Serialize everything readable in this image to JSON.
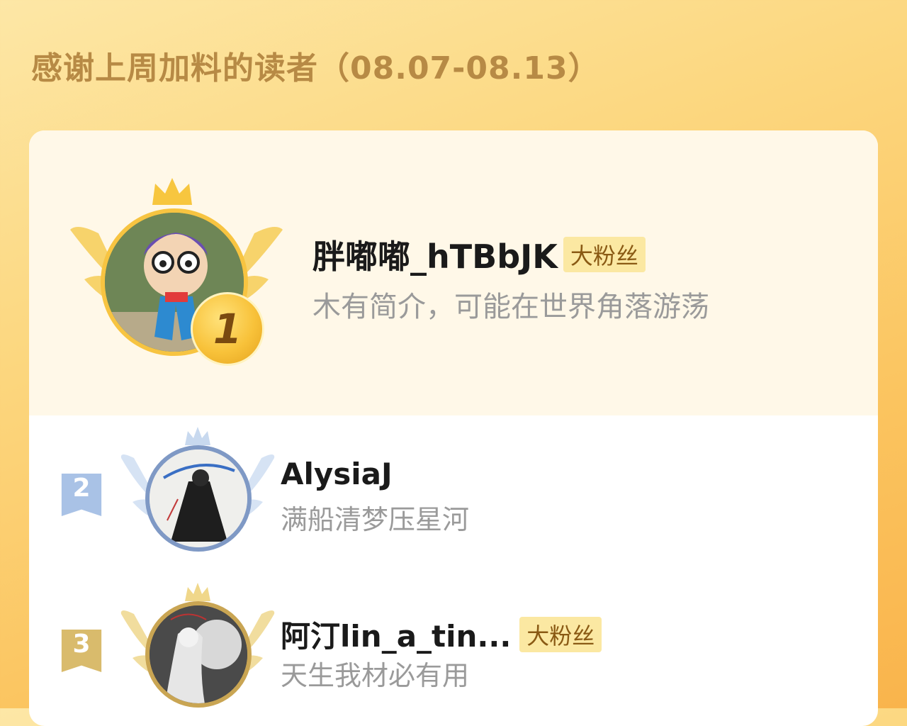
{
  "header": {
    "title": "感谢上周加料的读者（08.07-08.13）"
  },
  "ranking": [
    {
      "rank": "1",
      "name": "胖嘟嘟_hTBbJK",
      "tag": "大粉丝",
      "bio": "木有简介，可能在世界角落游荡",
      "avatar_icon": "user-avatar-figurine"
    },
    {
      "rank": "2",
      "name": "AlysiaJ",
      "tag": "",
      "bio": "满船清梦压星河",
      "avatar_icon": "user-avatar-illustration"
    },
    {
      "rank": "3",
      "name": "阿汀lin_a_tin...",
      "tag": "大粉丝",
      "bio": "天生我材必有用",
      "avatar_icon": "user-avatar-illustration"
    }
  ],
  "colors": {
    "gold": "#f7c441",
    "silver_blue": "#7f99c5",
    "bronze": "#c9a553",
    "tag_bg": "#fbe8a2",
    "title_color": "#b78a45"
  }
}
